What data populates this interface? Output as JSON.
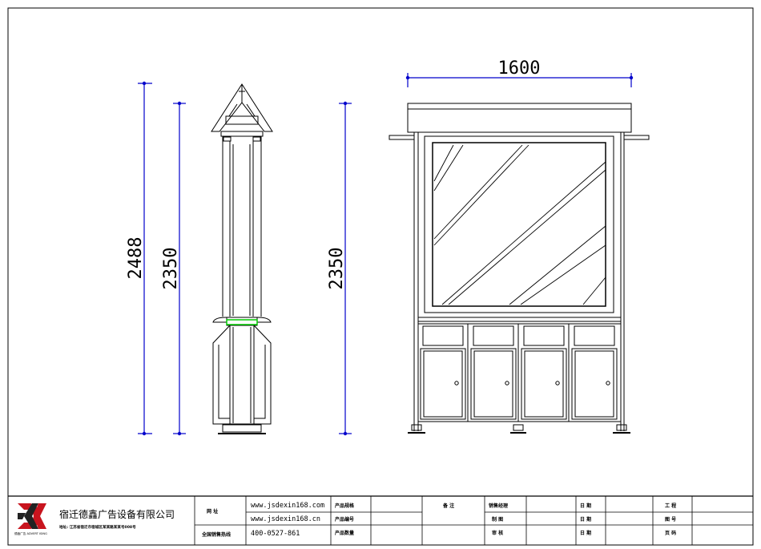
{
  "dimensions": {
    "front_width": "1600",
    "side_total_height": "2488",
    "side_body_height": "2350",
    "front_height": "2350"
  },
  "title_block": {
    "logo_text": "德鑫",
    "logo_small": "德鑫广告 ADVERT ISING",
    "company_name": "宿迁德鑫广告设备有限公司",
    "company_address": "地址: 江苏省宿迁市宿城区某某路某某号008号",
    "website_label": "网 址",
    "website_1": "www.jsdexin168.com",
    "website_2": "www.jsdexin168.cn",
    "hotline_label": "全国销售热线",
    "hotline": "400-0527-861",
    "product_spec_label": "产品规格",
    "product_number_label": "产品编号",
    "product_qty_label": "产品数量",
    "remarks_label": "备 注",
    "sales_manager_label": "销售经理",
    "drawer_label": "制 图",
    "reviewer_label": "审 核",
    "date_label_1": "日 期",
    "date_label_2": "日 期",
    "date_label_3": "日 期",
    "project_label": "工 程",
    "drawing_no_label": "图 号",
    "page_no_label": "页 码"
  },
  "colors": {
    "dimension_line": "#0000cc",
    "outline": "#000000",
    "highlight": "#00cc00"
  }
}
